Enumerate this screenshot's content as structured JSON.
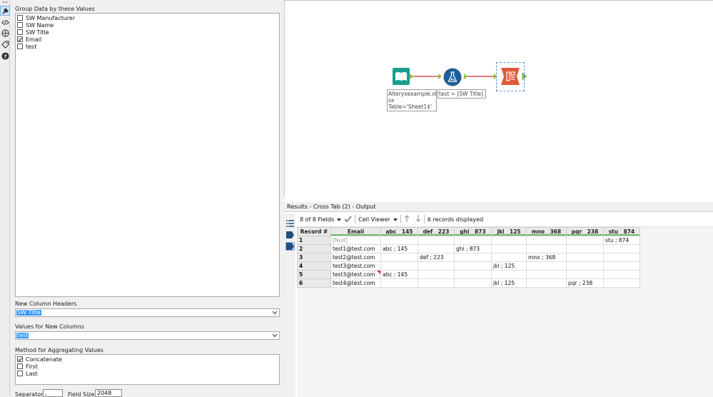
{
  "config": {
    "group_label": "Group Data by these Values",
    "group_fields": [
      {
        "label": "SW Manufacturer",
        "checked": false
      },
      {
        "label": "SW Name",
        "checked": false
      },
      {
        "label": "SW Title",
        "checked": false
      },
      {
        "label": "Email",
        "checked": true
      },
      {
        "label": "test",
        "checked": false
      }
    ],
    "new_headers_label": "New Column Headers",
    "new_headers_value": "SW Title",
    "values_label": "Values for New Columns",
    "values_value": "test",
    "method_label": "Method for Aggregating Values",
    "methods": [
      {
        "label": "Concatenate",
        "checked": true
      },
      {
        "label": "First",
        "checked": false
      },
      {
        "label": "Last",
        "checked": false
      }
    ],
    "separator_label": "Separator:",
    "separator_value": ",",
    "field_size_label": "Field Size:",
    "field_size_value": "2048"
  },
  "canvas": {
    "input_annotation": [
      "Alteryxexample.xl",
      "sx",
      "Table='Sheet1$'"
    ],
    "formula_annotation": "test = [SW Title]"
  },
  "results": {
    "title": "Results - Cross Tab (2) - Output",
    "fields_count": "8 of 8 Fields",
    "viewer": "Cell Viewer",
    "records_displayed": "6 records displayed",
    "columns": [
      "Record #",
      "Email",
      "abc__145",
      "def__223",
      "ghi__873",
      "jkl__125",
      "mno__368",
      "pqr__238",
      "stu__874"
    ],
    "rows": [
      [
        "1",
        "[Null]",
        "",
        "",
        "",
        "",
        "",
        "",
        "stu ; 874"
      ],
      [
        "2",
        "test1@test.com",
        "abc ; 145",
        "",
        "ghi ; 873",
        "",
        "",
        "",
        ""
      ],
      [
        "3",
        "test2@test.com",
        "",
        "def ; 223",
        "",
        "",
        "mno ; 368",
        "",
        ""
      ],
      [
        "4",
        "test3@test.com",
        "",
        "",
        "",
        "jkl ; 125",
        "",
        "",
        ""
      ],
      [
        "5",
        "test3@test.com",
        "abc ; 145",
        "",
        "",
        "",
        "",
        "",
        ""
      ],
      [
        "6",
        "test4@test.com",
        "",
        "",
        "",
        "jkl ; 125",
        "",
        "pqr ; 238",
        ""
      ]
    ]
  },
  "colors": {
    "input_tool": "#1a9e8f",
    "formula_tool": "#1f5f99",
    "crosstab_tool": "#e05a3a",
    "connector": "#cc3333",
    "anchor": "#8cc63f",
    "selection": "#3399ff"
  }
}
